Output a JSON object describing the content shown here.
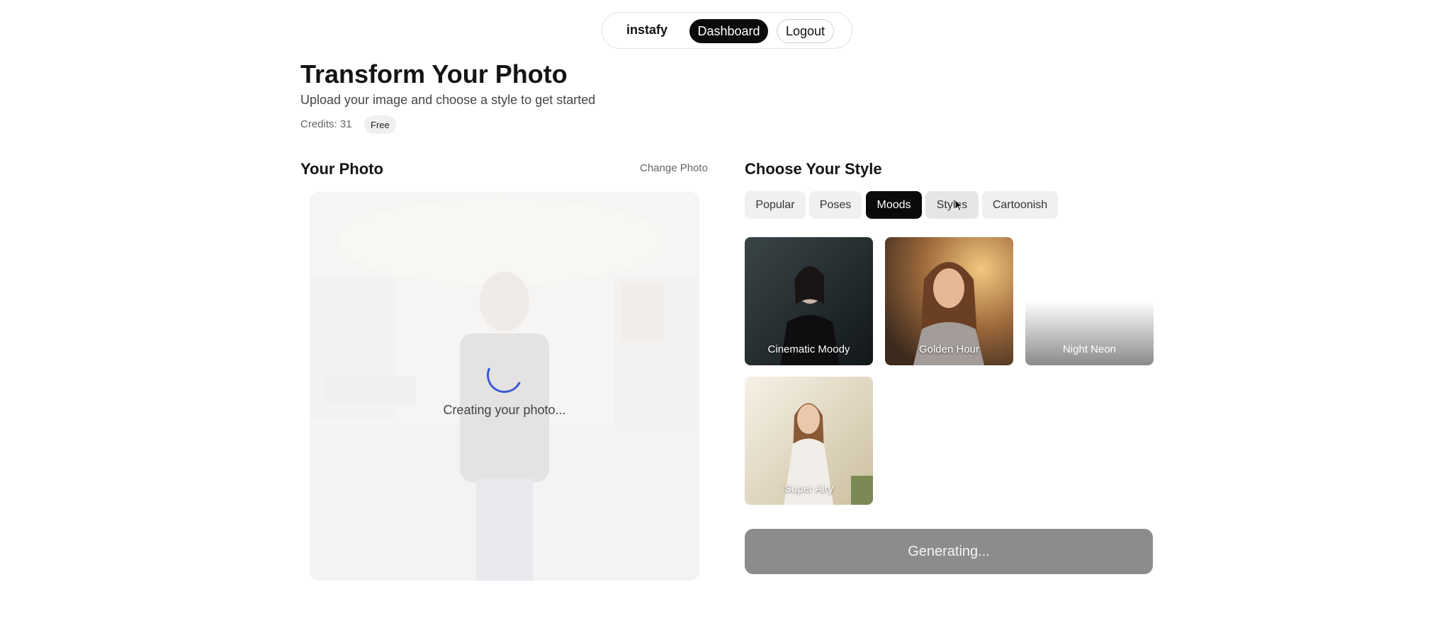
{
  "nav": {
    "brand": "instafy",
    "dashboard_label": "Dashboard",
    "logout_label": "Logout"
  },
  "header": {
    "title": "Transform Your Photo",
    "subtitle": "Upload your image and choose a style to get started",
    "credits_text": "Credits: 31",
    "plan_badge": "Free"
  },
  "photo_panel": {
    "title": "Your Photo",
    "change_label": "Change Photo",
    "status_text": "Creating your photo..."
  },
  "style_panel": {
    "title": "Choose Your Style",
    "tabs": [
      {
        "label": "Popular",
        "active": false
      },
      {
        "label": "Poses",
        "active": false
      },
      {
        "label": "Moods",
        "active": true
      },
      {
        "label": "Styles",
        "active": false
      },
      {
        "label": "Cartoonish",
        "active": false
      }
    ],
    "cards": [
      {
        "label": "Cinematic Moody"
      },
      {
        "label": "Golden Hour"
      },
      {
        "label": "Night Neon"
      },
      {
        "label": "Super Airy"
      }
    ],
    "generate_label": "Generating..."
  },
  "colors": {
    "accent": "#0a0a0a",
    "spinner": "#3b5bd6",
    "disabled_button": "#8c8c8c"
  }
}
